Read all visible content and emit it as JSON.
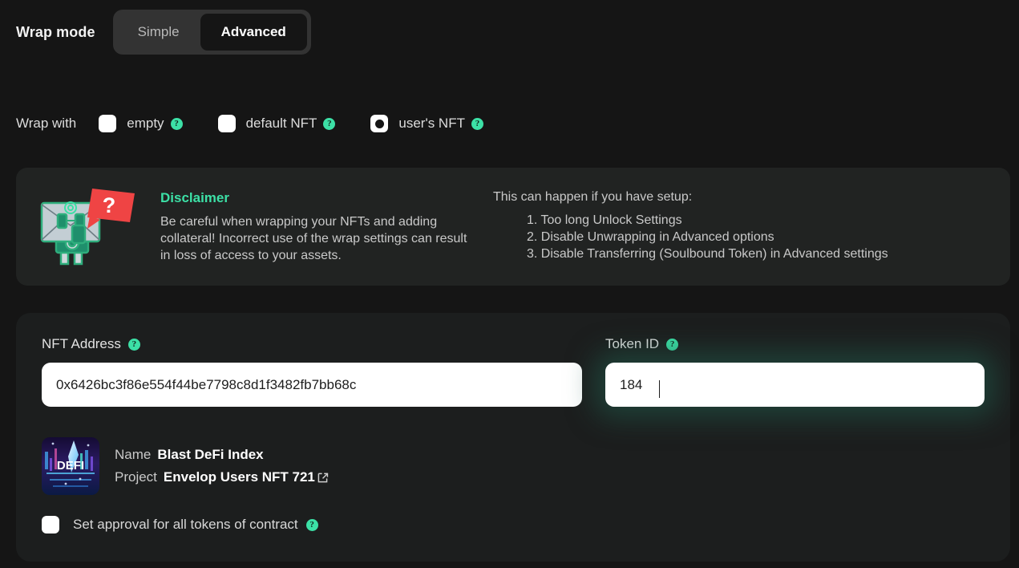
{
  "wrap_mode": {
    "label": "Wrap mode",
    "options": [
      {
        "label": "Simple",
        "active": false
      },
      {
        "label": "Advanced",
        "active": true
      }
    ]
  },
  "wrap_with": {
    "label": "Wrap with",
    "options": [
      {
        "label": "empty",
        "selected": false
      },
      {
        "label": "default NFT",
        "selected": false
      },
      {
        "label": "user's NFT",
        "selected": true
      }
    ],
    "help_glyph": "?"
  },
  "disclaimer": {
    "title": "Disclaimer",
    "body": "Be careful when wrapping your NFTs and adding collateral! Incorrect use of the wrap settings can result in loss of access to your assets.",
    "setup_intro": "This can happen if you have setup:",
    "setup_items": [
      "1. Too long Unlock Settings",
      "2. Disable Unwrapping in Advanced options",
      "3. Disable Transferring (Soulbound Token) in Advanced settings"
    ],
    "mascot_icon": "envelope-robot-question-icon"
  },
  "form": {
    "nft_address": {
      "label": "NFT Address",
      "value": "0x6426bc3f86e554f44be7798c8d1f3482fb7bb68c",
      "placeholder": "NFT Address"
    },
    "token_id": {
      "label": "Token ID",
      "value": "184",
      "placeholder": "Token ID",
      "focused": true
    },
    "nft_info": {
      "name_key": "Name",
      "name_value": "Blast DeFi Index",
      "project_key": "Project",
      "project_value": "Envelop Users NFT 721",
      "thumb_caption": "DEFI",
      "external_link_icon": "external-link-icon"
    },
    "approval": {
      "label": "Set approval for all tokens of  contract",
      "checked": false
    }
  },
  "colors": {
    "page_bg": "#151515",
    "panel_bg": "#212322",
    "card_bg": "#1c1e1e",
    "accent": "#3ce0a6",
    "toggle_track": "#333333",
    "text_primary": "#e2e2e2",
    "text_secondary": "#c9c9c9",
    "input_bg": "#ffffff",
    "danger": "#ef4444"
  }
}
